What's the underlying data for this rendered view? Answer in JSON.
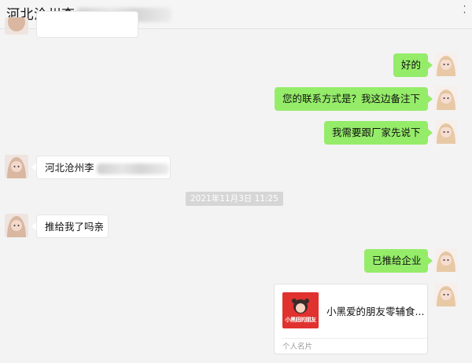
{
  "header": {
    "title": "河北沧州李",
    "more_icon": "more-dots-icon"
  },
  "messages": [
    {
      "side": "left",
      "text": ""
    },
    {
      "side": "right",
      "text": "好的"
    },
    {
      "side": "right",
      "text": "您的联系方式是？我这边备注下"
    },
    {
      "side": "right",
      "text": "我需要跟厂家先说下"
    },
    {
      "side": "left",
      "text": "河北沧州李"
    },
    {
      "side": "left",
      "text": "推给我了吗亲"
    },
    {
      "side": "right",
      "text": "已推给企业"
    }
  ],
  "timestamp": "2021年11月3日 11:25",
  "card": {
    "logo_text": "小黑妞的朋友",
    "name": "小黑爱的朋友零辅食...",
    "footer": "个人名片"
  },
  "colors": {
    "bubble_sent": "#95ec69",
    "bubble_received": "#ffffff",
    "background": "#f3f3f3",
    "card_logo": "#e0322f"
  }
}
